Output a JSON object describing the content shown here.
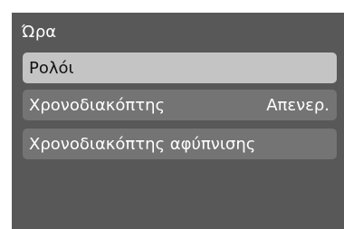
{
  "screen": {
    "title": "Ώρα",
    "colors": {
      "background": "#585858",
      "item_background": "#747474",
      "selected_background": "#c4c4c4",
      "selected_text": "#111111",
      "text": "#ffffff"
    }
  },
  "menu": {
    "items": [
      {
        "label": "Ρολόι",
        "value": "",
        "selected": true
      },
      {
        "label": "Χρονοδιακόπτης",
        "value": "Απενερ.",
        "selected": false
      },
      {
        "label": "Χρονοδιακόπτης αφύπνισης",
        "value": "",
        "selected": false
      }
    ]
  }
}
